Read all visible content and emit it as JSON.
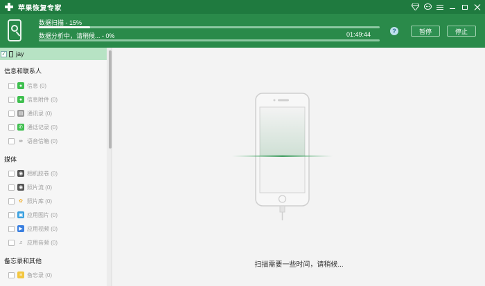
{
  "titlebar": {
    "app_title": "苹果恢复专家",
    "icons": [
      "diamond-icon",
      "chat-icon",
      "menu-icon",
      "minimize-icon",
      "restore-icon",
      "close-icon"
    ]
  },
  "header": {
    "scan_label": "数据扫描 - 15%",
    "scan_progress": 0.15,
    "analysis_label": "数据分析中，请稍候... - 0%",
    "analysis_progress": 0.0,
    "time": "01:49:44",
    "help": "?",
    "pause_label": "暂停",
    "stop_label": "停止"
  },
  "sidebar": {
    "device_name": "jay",
    "sections": [
      {
        "title": "信息和联系人",
        "items": [
          {
            "label": "信息 (0)",
            "icon": "messages-icon",
            "color": "#3fbf4f"
          },
          {
            "label": "信息附件 (0)",
            "icon": "attachment-icon",
            "color": "#3fbf4f"
          },
          {
            "label": "通讯录 (0)",
            "icon": "contacts-icon",
            "color": "#9a9a9a"
          },
          {
            "label": "通话记录 (0)",
            "icon": "phone-icon",
            "color": "#3fbf4f"
          },
          {
            "label": "语音信箱 (0)",
            "icon": "voicemail-icon",
            "color": "#666666"
          }
        ]
      },
      {
        "title": "媒体",
        "items": [
          {
            "label": "相机胶卷 (0)",
            "icon": "camera-icon",
            "color": "#555555"
          },
          {
            "label": "照片流 (0)",
            "icon": "photostream-icon",
            "color": "#555555"
          },
          {
            "label": "照片库 (0)",
            "icon": "photos-icon",
            "color": "#f0b030"
          },
          {
            "label": "应用图片 (0)",
            "icon": "app-photo-icon",
            "color": "#3aa0e0"
          },
          {
            "label": "应用视频 (0)",
            "icon": "app-video-icon",
            "color": "#3a7fe0"
          },
          {
            "label": "应用音频 (0)",
            "icon": "app-audio-icon",
            "color": "#888888"
          }
        ]
      },
      {
        "title": "备忘录和其他",
        "items": [
          {
            "label": "备忘录 (0)",
            "icon": "notes-icon",
            "color": "#f3c640"
          }
        ]
      }
    ]
  },
  "main": {
    "scan_message": "扫描需要一些时间，请稍候..."
  },
  "colors": {
    "title_bg": "#1f7a3f",
    "header_bg": "#2a8a4a",
    "selected_row": "#b7e3c4"
  }
}
